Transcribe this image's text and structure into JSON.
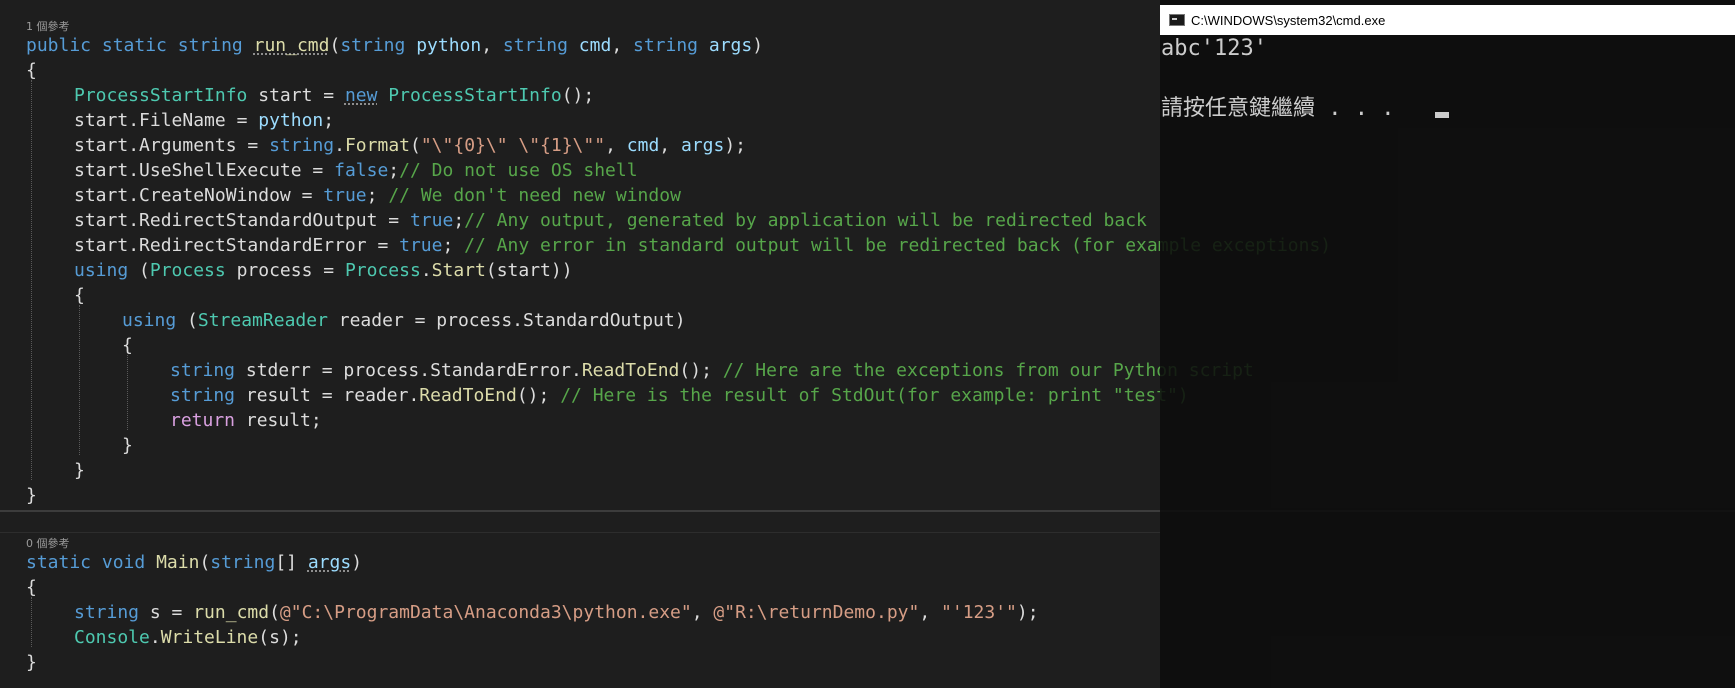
{
  "editor": {
    "run_cmd": {
      "references": "1 個參考",
      "l1": {
        "a": "public",
        "b": "static",
        "c": "string",
        "d": "run_cmd",
        "e": "(",
        "f": "string",
        "g": "python",
        "h": ", ",
        "i": "string",
        "j": "cmd",
        "k": ", ",
        "l": "string",
        "m": "args",
        "n": ")"
      },
      "l2": "{",
      "l3": {
        "a": "ProcessStartInfo",
        "b": " start = ",
        "c": "new",
        "d": " ",
        "e": "ProcessStartInfo",
        "f": "();"
      },
      "l4": {
        "a": "start",
        "b": ".",
        "c": "FileName",
        "d": " = ",
        "e": "python",
        "f": ";"
      },
      "l5": {
        "a": "start",
        "b": ".",
        "c": "Arguments",
        "d": " = ",
        "e": "string",
        "f": ".",
        "g": "Format",
        "h": "(",
        "i": "\"\\\"{0}\\\" \\\"{1}\\\"\"",
        "j": ", ",
        "k": "cmd",
        "l": ", ",
        "m": "args",
        "n": ");"
      },
      "l6": {
        "a": "start",
        "b": ".",
        "c": "UseShellExecute",
        "d": " = ",
        "e": "false",
        "f": ";",
        "g": "// Do not use OS shell"
      },
      "l7": {
        "a": "start",
        "b": ".",
        "c": "CreateNoWindow",
        "d": " = ",
        "e": "true",
        "f": "; ",
        "g": "// We don't need new window"
      },
      "l8": {
        "a": "start",
        "b": ".",
        "c": "RedirectStandardOutput",
        "d": " = ",
        "e": "true",
        "f": ";",
        "g": "// Any output, generated by application will be redirected back"
      },
      "l9": {
        "a": "start",
        "b": ".",
        "c": "RedirectStandardError",
        "d": " = ",
        "e": "true",
        "f": "; ",
        "g": "// Any error in standard output will be redirected back (for example exceptions)"
      },
      "l10": {
        "a": "using",
        "b": " (",
        "c": "Process",
        "d": " process = ",
        "e": "Process",
        "f": ".",
        "g": "Start",
        "h": "(",
        "i": "start",
        "j": "))"
      },
      "l11": "{",
      "l12": {
        "a": "using",
        "b": " (",
        "c": "StreamReader",
        "d": " reader = ",
        "e": "process",
        "f": ".",
        "g": "StandardOutput",
        "h": ")"
      },
      "l13": "{",
      "l14": {
        "a": "string",
        "b": " stderr = ",
        "c": "process",
        "d": ".",
        "e": "StandardError",
        "f": ".",
        "g": "ReadToEnd",
        "h": "(); ",
        "i": "// Here are the exceptions from our Python script"
      },
      "l15": {
        "a": "string",
        "b": " result = ",
        "c": "reader",
        "d": ".",
        "e": "ReadToEnd",
        "f": "(); ",
        "g": "// Here is the result of StdOut(for example: print \"test\")"
      },
      "l16": {
        "a": "return",
        "b": " ",
        "c": "result",
        "d": ";"
      },
      "l17": "}",
      "l18": "}",
      "l19": "}"
    },
    "main": {
      "references": "0 個參考",
      "l1": {
        "a": "static",
        "b": "void",
        "c": "Main",
        "d": "(",
        "e": "string",
        "f": "[] ",
        "g": "args",
        "h": ")"
      },
      "l2": "{",
      "l3": {
        "a": "string",
        "b": " s = ",
        "c": "run_cmd",
        "d": "(",
        "e": "@\"C:\\ProgramData\\Anaconda3\\python.exe\"",
        "f": ", ",
        "g": "@\"R:\\returnDemo.py\"",
        "h": ", ",
        "i": "\"'123'\"",
        "j": ");"
      },
      "l4": {
        "a": "Console",
        "b": ".",
        "c": "WriteLine",
        "d": "(",
        "e": "s",
        "f": ");"
      },
      "l5": "}"
    }
  },
  "console": {
    "title": "C:\\WINDOWS\\system32\\cmd.exe",
    "output_line1": "abc'123'",
    "output_line2": "請按任意鍵繼續 . . ."
  },
  "colors": {
    "background": "#1e1e1e",
    "keyword": "#569cd6",
    "type": "#4ec9b0",
    "method": "#dcdcaa",
    "variable": "#9cdcfe",
    "string": "#d69d85",
    "comment": "#57a64a",
    "control": "#d8a0df",
    "console_background": "#0c0c0c"
  }
}
